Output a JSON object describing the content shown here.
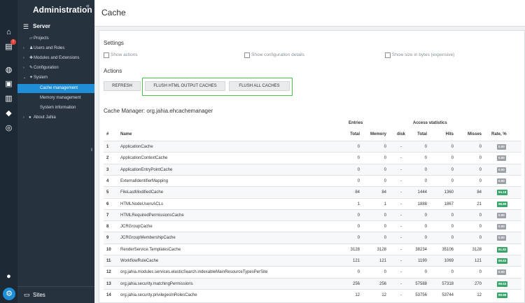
{
  "nav": {
    "title": "Administration",
    "collapse_icon": "double-chevron-left-icon",
    "server_label": "Server",
    "sites_label": "Sites",
    "items": [
      {
        "label": "Projects",
        "caret": "",
        "icon": "projects"
      },
      {
        "label": "Users and Roles",
        "caret": "›",
        "icon": "users"
      },
      {
        "label": "Modules and Extensions",
        "caret": "›",
        "icon": "modules"
      },
      {
        "label": "Configuration",
        "caret": "›",
        "icon": "configuration"
      },
      {
        "label": "System",
        "caret": "⌄",
        "icon": "system"
      },
      {
        "label": "Cache management",
        "caret": "",
        "icon": "",
        "active": true
      },
      {
        "label": "Memory management",
        "caret": "",
        "icon": ""
      },
      {
        "label": "System information",
        "caret": "",
        "icon": ""
      },
      {
        "label": "About Jahia",
        "caret": "›",
        "icon": "about"
      }
    ]
  },
  "rail": {
    "badge": "!",
    "icons": [
      "home-icon",
      "clipboard-icon",
      "globe-icon",
      "pages-icon",
      "chart-icon",
      "tag-icon",
      "compass-icon",
      "user-icon",
      "gear-icon"
    ]
  },
  "header": {
    "title": "Cache"
  },
  "settings": {
    "heading": "Settings",
    "checkboxes": [
      "Show actions",
      "Show configuration details",
      "Show size in bytes (expensive)"
    ]
  },
  "actions": {
    "heading": "Actions",
    "buttons": [
      "REFRESH",
      "FLUSH HTML OUTPUT CACHES",
      "FLUSH ALL CACHES"
    ]
  },
  "cache_manager": {
    "title": "Cache Manager: org.jahia.ehcachemanager",
    "group_headers": {
      "entries": "Entries",
      "access": "Access statistics"
    },
    "columns": [
      "#",
      "Name",
      "Total",
      "Memory",
      "disk",
      "Total",
      "Hits",
      "Misses",
      "Rate, %"
    ],
    "rows": [
      {
        "n": "1",
        "name": "ApplicationCache",
        "total": "0",
        "memory": "0",
        "disk": "-",
        "atotal": "0",
        "hits": "0",
        "misses": "0",
        "rate": "0.00"
      },
      {
        "n": "2",
        "name": "ApplicationContextCache",
        "total": "0",
        "memory": "0",
        "disk": "-",
        "atotal": "0",
        "hits": "0",
        "misses": "0",
        "rate": "0.00"
      },
      {
        "n": "3",
        "name": "ApplicationEntryPointCache",
        "total": "0",
        "memory": "0",
        "disk": "-",
        "atotal": "0",
        "hits": "0",
        "misses": "0",
        "rate": "0.00"
      },
      {
        "n": "4",
        "name": "ExternalIdentifierMapping",
        "total": "0",
        "memory": "0",
        "disk": "-",
        "atotal": "0",
        "hits": "0",
        "misses": "0",
        "rate": "0.00"
      },
      {
        "n": "5",
        "name": "FileLastModifiedCache",
        "total": "84",
        "memory": "84",
        "disk": "-",
        "atotal": "1444",
        "hits": "1360",
        "misses": "84",
        "rate": "94.18"
      },
      {
        "n": "6",
        "name": "HTMLNodeUsersACLs",
        "total": "1",
        "memory": "1",
        "disk": "-",
        "atotal": "1888",
        "hits": "1867",
        "misses": "21",
        "rate": "98.89"
      },
      {
        "n": "7",
        "name": "HTMLRequiredPermissionsCache",
        "total": "0",
        "memory": "0",
        "disk": "-",
        "atotal": "0",
        "hits": "0",
        "misses": "0",
        "rate": "0.00"
      },
      {
        "n": "8",
        "name": "JCRGroupCache",
        "total": "0",
        "memory": "0",
        "disk": "-",
        "atotal": "0",
        "hits": "0",
        "misses": "0",
        "rate": "0.00"
      },
      {
        "n": "9",
        "name": "JCRGroupMembershipCache",
        "total": "0",
        "memory": "0",
        "disk": "-",
        "atotal": "0",
        "hits": "0",
        "misses": "0",
        "rate": "0.00"
      },
      {
        "n": "10",
        "name": "RenderService.TemplatesCache",
        "total": "3128",
        "memory": "3128",
        "disk": "-",
        "atotal": "38234",
        "hits": "35106",
        "misses": "3128",
        "rate": "91.82"
      },
      {
        "n": "11",
        "name": "WorkflowRuleCache",
        "total": "121",
        "memory": "121",
        "disk": "-",
        "atotal": "1190",
        "hits": "1069",
        "misses": "121",
        "rate": "89.83"
      },
      {
        "n": "12",
        "name": "org.jahia.modules.services.elasticSearch.indexableMainResourceTypesPerSite",
        "total": "0",
        "memory": "0",
        "disk": "-",
        "atotal": "0",
        "hits": "0",
        "misses": "0",
        "rate": "0.00"
      },
      {
        "n": "13",
        "name": "org.jahia.security.matchingPermissions",
        "total": "256",
        "memory": "256",
        "disk": "-",
        "atotal": "57588",
        "hits": "57318",
        "misses": "270",
        "rate": "99.53"
      },
      {
        "n": "14",
        "name": "org.jahia.security.privilegesInRolesCache",
        "total": "12",
        "memory": "12",
        "disk": "-",
        "atotal": "53756",
        "hits": "53744",
        "misses": "12",
        "rate": "99.98"
      }
    ]
  },
  "colors": {
    "accent": "#1f8ed6",
    "rate_good": "#3aa56a",
    "rate_zero": "#9aa0a5",
    "highlight": "#48c44a"
  }
}
